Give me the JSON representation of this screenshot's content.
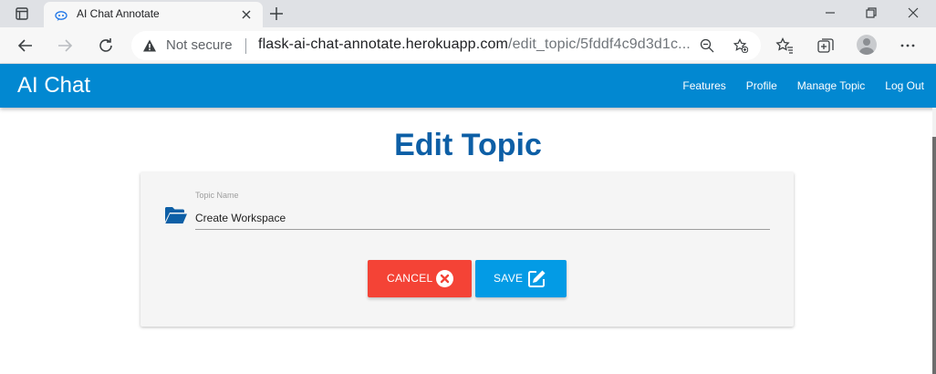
{
  "browser": {
    "tab_title": "AI Chat Annotate",
    "address": {
      "security_label": "Not secure",
      "url_host": "flask-ai-chat-annotate.herokuapp.com",
      "url_path": "/edit_topic/5fddf4c9d3d1c..."
    }
  },
  "navbar": {
    "brand": "AI Chat",
    "links": [
      "Features",
      "Profile",
      "Manage Topic",
      "Log Out"
    ],
    "color": "#0288d1"
  },
  "main": {
    "title": "Edit Topic",
    "form": {
      "field_label": "Topic Name",
      "field_value": "Create Workspace",
      "cancel_label": "CANCEL",
      "save_label": "SAVE"
    }
  },
  "colors": {
    "cancel": "#f44336",
    "save": "#039be5",
    "title": "#0d5fa6"
  }
}
